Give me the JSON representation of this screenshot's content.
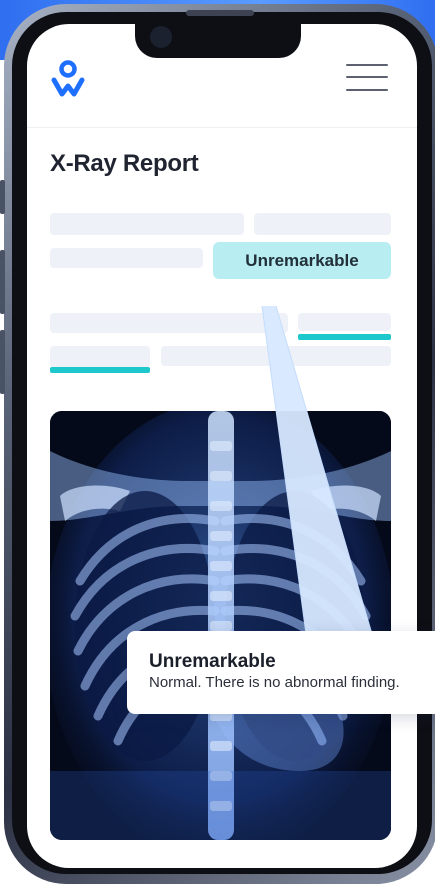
{
  "header": {
    "logo_icon": "person-logo-icon",
    "menu_icon": "hamburger-menu-icon"
  },
  "page": {
    "title": "X-Ray Report"
  },
  "report": {
    "result_label": "Unremarkable"
  },
  "tooltip": {
    "title": "Unremarkable",
    "description": "Normal. There is no abnormal finding."
  },
  "colors": {
    "brand_blue": "#1f6fff",
    "accent_teal": "#1cc8cc",
    "badge_bg": "#b8eef2"
  }
}
